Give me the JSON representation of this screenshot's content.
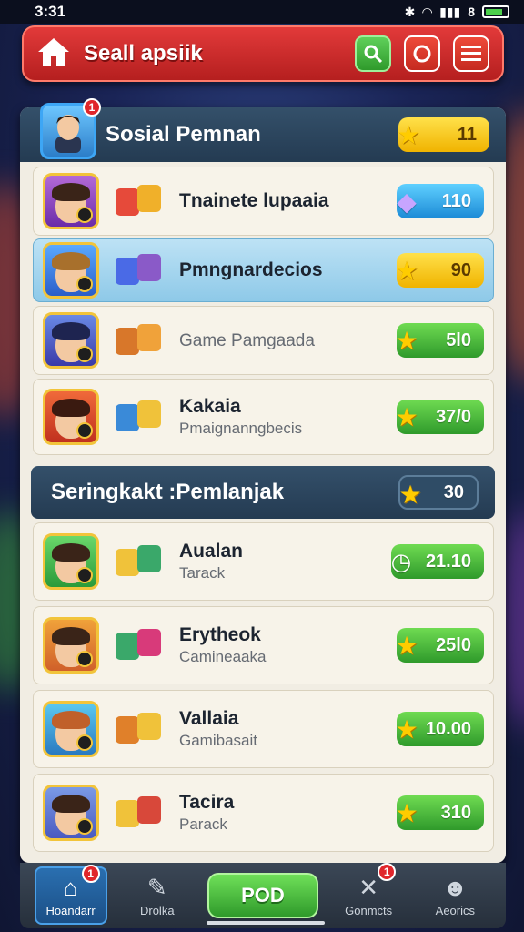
{
  "status_bar": {
    "time": "3:31",
    "battery_level": "8"
  },
  "header": {
    "title": "Seall apsiik",
    "search_icon": "search-icon",
    "record_icon": "record-icon",
    "menu_icon": "menu-icon"
  },
  "section1": {
    "title": "Sosial Pemnan",
    "notif_count": "1",
    "score": "11",
    "rows": [
      {
        "name": "Tnainete lupaaia",
        "subtitle": "",
        "score": "110",
        "pill": "blue",
        "highlight": false
      },
      {
        "name": "Pmngnardecios",
        "subtitle": "",
        "score": "90",
        "pill": "gold",
        "highlight": true
      },
      {
        "name": "",
        "subtitle": "Game Pamgaada",
        "score": "5l0",
        "pill": "green",
        "highlight": false
      },
      {
        "name": "Kakaia",
        "subtitle": "Pmaignanngbecis",
        "score": "37/0",
        "pill": "green",
        "highlight": false
      }
    ]
  },
  "section2": {
    "title": "Seringkakt :Pemlanjak",
    "score": "30",
    "rows": [
      {
        "name": "Aualan",
        "subtitle": "Tarack",
        "score": "21.10",
        "pill": "green"
      },
      {
        "name": "Erytheok",
        "subtitle": "Camineaaka",
        "score": "25l0",
        "pill": "green"
      },
      {
        "name": "Vallaia",
        "subtitle": "Gamibasait",
        "score": "10.00",
        "pill": "green"
      },
      {
        "name": "Tacira",
        "subtitle": "Parack",
        "score": "310",
        "pill": "green"
      }
    ]
  },
  "tabbar": {
    "tabs": [
      {
        "label": "Hoandarr",
        "badge": "1"
      },
      {
        "label": "Drolka",
        "badge": ""
      },
      {
        "label": "Gonmcts",
        "badge": "1"
      },
      {
        "label": "Aeorics",
        "badge": ""
      }
    ],
    "play_label": "POD"
  },
  "colors": {
    "header_red": "#d42e2e",
    "accent_blue": "#1c8ad6",
    "accent_green": "#2f9a2b",
    "gold": "#f0b300"
  }
}
